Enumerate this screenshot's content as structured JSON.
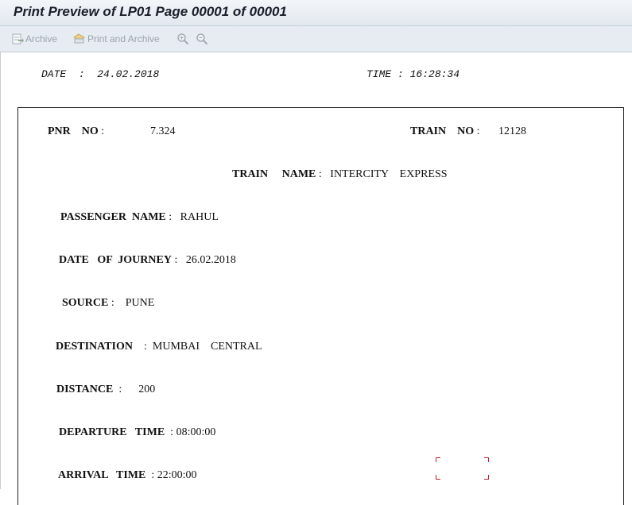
{
  "window": {
    "title": "Print Preview of LP01 Page 00001 of 00001"
  },
  "toolbar": {
    "archive_label": "Archive",
    "print_archive_label": "Print and Archive",
    "zoom_in_icon": "zoom-in-icon",
    "zoom_out_icon": "zoom-out-icon"
  },
  "header": {
    "date_label": "DATE",
    "date_value": "24.02.2018",
    "time_label": "TIME",
    "time_value": "16:28:34"
  },
  "ticket": {
    "pnr_label": "PNR    NO",
    "pnr_value": "7.324",
    "train_no_label": "TRAIN    NO",
    "train_no_value": "12128",
    "train_name_label": "TRAIN     NAME",
    "train_name_value": "INTERCITY    EXPRESS",
    "passenger_label": "PASSENGER  NAME",
    "passenger_value": "RAHUL",
    "journey_label": "DATE   OF  JOURNEY",
    "journey_value": "26.02.2018",
    "source_label": "SOURCE",
    "source_value": "PUNE",
    "destination_label": "DESTINATION",
    "destination_value": "MUMBAI    CENTRAL",
    "distance_label": "DISTANCE",
    "distance_value": "200",
    "departure_label": "DEPARTURE   TIME",
    "departure_value": "08:00:00",
    "arrival_label": "ARRIVAL   TIME",
    "arrival_value": "22:00:00"
  },
  "colors": {
    "toolbar_bg": "#e7ecf2",
    "disabled_text": "#9aa3ad",
    "marker": "#c2202a"
  }
}
